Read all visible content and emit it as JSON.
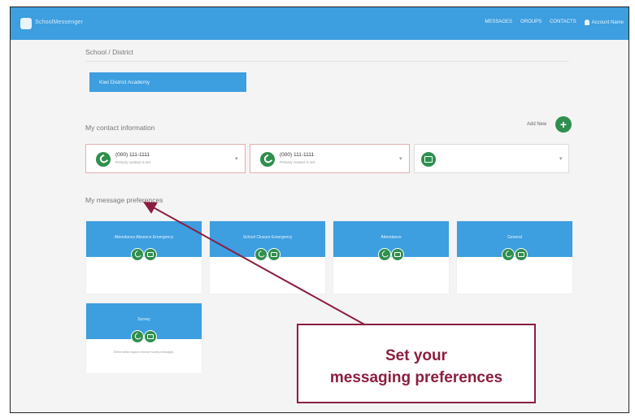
{
  "app": {
    "name": "SchoolMessenger",
    "nav": [
      "MESSAGES",
      "GROUPS",
      "CONTACTS"
    ],
    "user": "Account Name"
  },
  "district": {
    "section_title": "School / District",
    "button_label": "Kiwi District Academy"
  },
  "contacts": {
    "section_title": "My contact information",
    "add_label": "Add New",
    "cards": [
      {
        "number": "(000) 111-1111",
        "sub": "Primary contact is set",
        "type": "phone"
      },
      {
        "number": "(000) 111-1111",
        "sub": "Primary contact is set",
        "type": "phone"
      },
      {
        "number": "",
        "sub": "",
        "type": "email"
      }
    ]
  },
  "preferences": {
    "section_title": "My message preferences",
    "cards": [
      {
        "label": "Attendance Absence Emergency",
        "note": ""
      },
      {
        "label": "School Closure Emergency",
        "note": ""
      },
      {
        "label": "Attendance",
        "note": ""
      },
      {
        "label": "General",
        "note": ""
      },
      {
        "label": "Survey",
        "note": "Select which ways to receive Survey messages."
      }
    ]
  },
  "callout": {
    "line1": "Set your",
    "line2": "messaging preferences"
  },
  "colors": {
    "accent": "#3d9ee0",
    "green": "#2f8f4e",
    "callout": "#8b1e3f"
  }
}
